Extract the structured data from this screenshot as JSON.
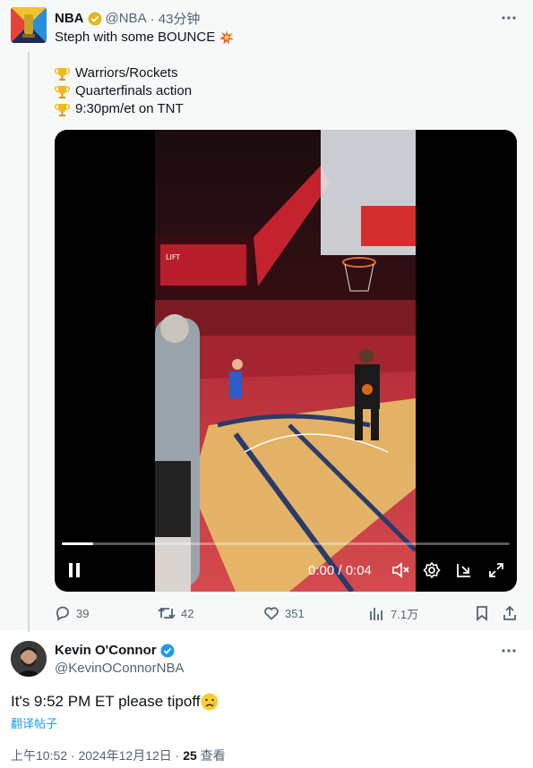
{
  "original_tweet": {
    "author_name": "NBA",
    "handle": "@NBA",
    "time": "· 43分钟",
    "text_line1": "Steph with some BOUNCE",
    "bullets": [
      "Warriors/Rockets",
      "Quarterfinals action",
      "9:30pm/et on TNT"
    ],
    "video": {
      "time_display": "0:00 / 0:04",
      "progress": 0.07,
      "arena_sign": "LIFT"
    },
    "actions": {
      "replies": "39",
      "retweets": "42",
      "likes": "351",
      "views": "7.1万"
    }
  },
  "reply": {
    "author_name": "Kevin O'Connor",
    "handle": "@KevinOConnorNBA",
    "text": "It's 9:52 PM ET please tipoff",
    "translate": "翻译帖子",
    "timestamp": "上午10:52 · 2024年12月12日 · ",
    "views_count": "25",
    "views_label": " 查看"
  },
  "colors": {
    "verified_gold": "#e2b719",
    "verified_blue": "#1d9bf0",
    "link": "#1d9bf0",
    "court_red": "#c8303a"
  },
  "icons": [
    "more-icon",
    "trophy-icon",
    "collision-emoji",
    "pause-icon",
    "mute-icon",
    "settings-icon",
    "pip-icon",
    "fullscreen-icon",
    "reply-icon",
    "retweet-icon",
    "like-icon",
    "views-icon",
    "bookmark-icon",
    "share-icon",
    "sad-face-emoji"
  ]
}
